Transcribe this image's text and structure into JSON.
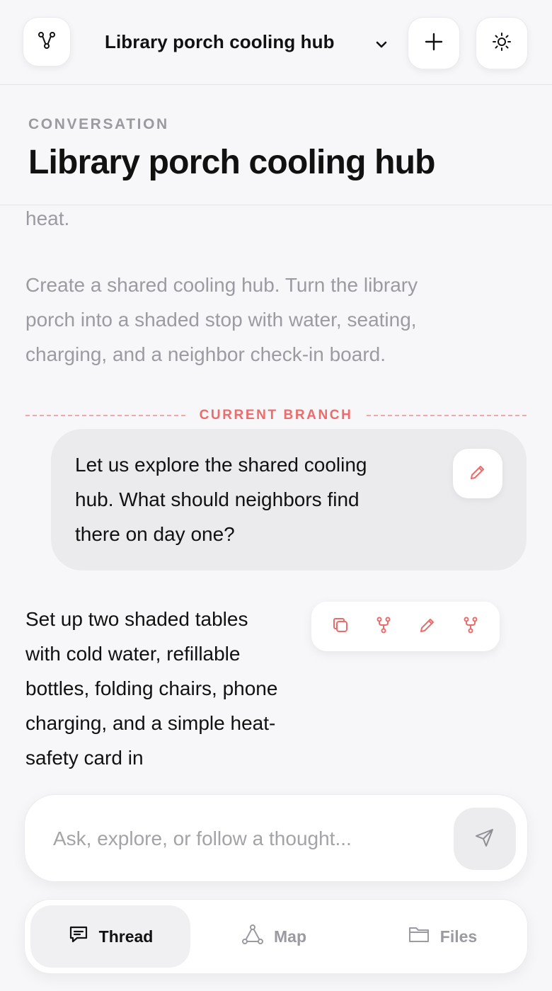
{
  "app": {
    "title": "Library porch cooling hub"
  },
  "header": {
    "eyebrow": "CONVERSATION",
    "title": "Library porch cooling hub"
  },
  "thread": {
    "earlier_fragment": "heat.",
    "earlier_message": "Create a shared cooling hub. Turn the library porch into a shaded stop with water, seating, charging, and a neighbor check-in board.",
    "branch_label": "CURRENT BRANCH",
    "user_message": "Let us explore the shared cooling hub. What should neighbors find there on day one?",
    "assistant_message": "Set up two shaded tables with cold water, refillable bottles, folding chairs, phone charging, and a simple heat-safety card in"
  },
  "composer": {
    "placeholder": "Ask, explore, or follow a thought..."
  },
  "tabs": [
    {
      "label": "Thread",
      "icon": "chat-icon",
      "active": true
    },
    {
      "label": "Map",
      "icon": "graph-icon",
      "active": false
    },
    {
      "label": "Files",
      "icon": "folder-icon",
      "active": false
    }
  ],
  "colors": {
    "accent": "#ec6b6b",
    "background": "#f7f7f9",
    "bubble": "#ebebed",
    "muted": "#9b9ba1"
  }
}
